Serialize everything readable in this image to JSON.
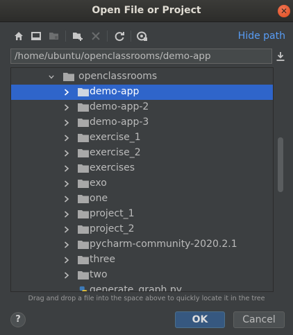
{
  "window": {
    "title": "Open File or Project",
    "close_glyph": "✕"
  },
  "toolbar": {
    "icons": [
      "home-icon",
      "desktop-icon",
      "project-folder-icon",
      "new-folder-icon",
      "delete-icon",
      "refresh-icon",
      "show-hidden-icon"
    ],
    "hide_path_label": "Hide path"
  },
  "path": {
    "value": "/home/ubuntu/openclassrooms/demo-app"
  },
  "tree": {
    "parent": "openclassrooms",
    "items": [
      {
        "label": "demo-app",
        "selected": true
      },
      {
        "label": "demo-app-2"
      },
      {
        "label": "demo-app-3"
      },
      {
        "label": "exercise_1"
      },
      {
        "label": "exercise_2"
      },
      {
        "label": "exercises"
      },
      {
        "label": "exo"
      },
      {
        "label": "one"
      },
      {
        "label": "project_1"
      },
      {
        "label": "project_2"
      },
      {
        "label": "pycharm-community-2020.2.1"
      },
      {
        "label": "three"
      },
      {
        "label": "two"
      }
    ],
    "file": {
      "label": "generate_graph.py",
      "icon": "python-file-icon"
    }
  },
  "hint": "Drag and drop a file into the space above to quickly locate it in the tree",
  "footer": {
    "help_label": "?",
    "ok_label": "OK",
    "cancel_label": "Cancel"
  },
  "colors": {
    "selection": "#2f65ca",
    "link": "#589df6",
    "background": "#3c3f41"
  }
}
